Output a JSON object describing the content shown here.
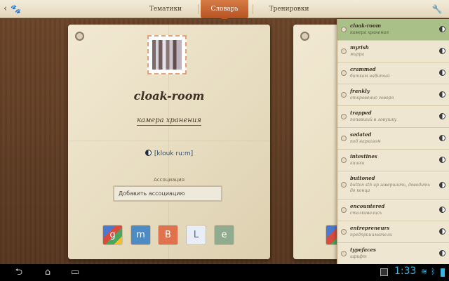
{
  "topbar": {
    "back_icon": "chevron-left",
    "paw_icon": "paw",
    "tabs": [
      {
        "label": "Тематики",
        "active": false
      },
      {
        "label": "Словарь",
        "active": true
      },
      {
        "label": "Тренировки",
        "active": false
      }
    ],
    "settings_icon": "wrench-screwdriver"
  },
  "card": {
    "word": "cloak-room",
    "translation": "камера хранения",
    "transcription": "[klouk ru:m]",
    "association_label": "Ассоциация",
    "association_placeholder": "Добавить ассоциацию",
    "tools": [
      {
        "name": "google-translate",
        "glyph": "g"
      },
      {
        "name": "multitran",
        "glyph": "m"
      },
      {
        "name": "dictionary-book",
        "glyph": "B"
      },
      {
        "name": "lingvo",
        "glyph": "L"
      },
      {
        "name": "pronunciation",
        "glyph": "e"
      }
    ]
  },
  "word_list": [
    {
      "word": "cloak-room",
      "translation": "камера хранения",
      "selected": true
    },
    {
      "word": "myrish",
      "translation": "мирра",
      "selected": false
    },
    {
      "word": "crammed",
      "translation": "битком набитый",
      "selected": false
    },
    {
      "word": "frankly",
      "translation": "откровенно говоря",
      "selected": false
    },
    {
      "word": "trapped",
      "translation": "попавший в ловушку",
      "selected": false
    },
    {
      "word": "sedated",
      "translation": "под наркозом",
      "selected": false
    },
    {
      "word": "intestines",
      "translation": "кишки",
      "selected": false
    },
    {
      "word": "buttoned",
      "translation": "button sth up завершить, доводить до конца",
      "selected": false
    },
    {
      "word": "encountered",
      "translation": "сталкивались",
      "selected": false
    },
    {
      "word": "entrepreneurs",
      "translation": "предприниматели",
      "selected": false
    },
    {
      "word": "typefaces",
      "translation": "шрифт",
      "selected": false
    }
  ],
  "system_bar": {
    "clock": "1:33"
  }
}
